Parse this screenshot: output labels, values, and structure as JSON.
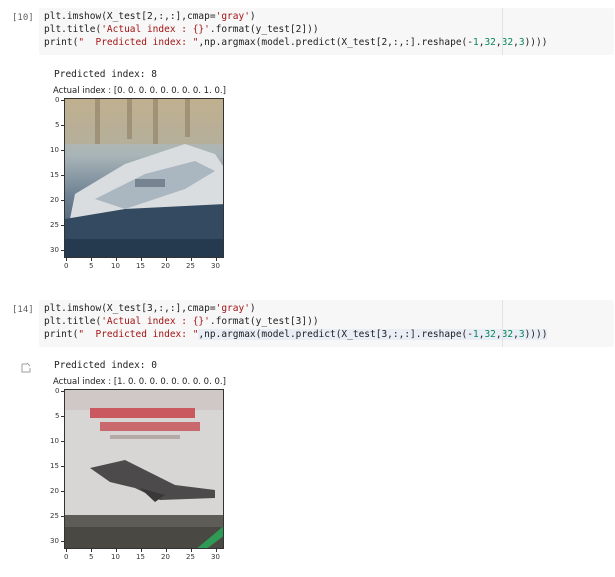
{
  "cells": [
    {
      "prompt": "[10]",
      "code": {
        "line1_a": "plt.imshow(X_test[2,:,:],cmap=",
        "line1_str": "'gray'",
        "line1_b": ")",
        "line2_a": "plt.title(",
        "line2_str": "'Actual index : {}'",
        "line2_b": ".format(y_test[2]))",
        "line3_a": "print(",
        "line3_str": "\"  Predicted index: \"",
        "line3_b": ",np.argmax(model.predict(X_test[2,:,:].reshape(-",
        "line3_n1": "1",
        "line3_c": ",",
        "line3_n2": "32",
        "line3_d": ",",
        "line3_n3": "32",
        "line3_e": ",",
        "line3_n4": "3",
        "line3_f": "))))"
      },
      "output_text": "Predicted index:  8",
      "plot_title": "Actual index : [0. 0. 0. 0. 0. 0. 0. 0. 1. 0.]",
      "y_ticks": [
        "0",
        "5",
        "10",
        "15",
        "20",
        "25",
        "30"
      ],
      "x_ticks": [
        "0",
        "5",
        "10",
        "15",
        "20",
        "25",
        "30"
      ]
    },
    {
      "prompt": "[14]",
      "code": {
        "line1_a": "plt.imshow(X_test[3,:,:],cmap=",
        "line1_str": "'gray'",
        "line1_b": ")",
        "line2_a": "plt.title(",
        "line2_str": "'Actual index : {}'",
        "line2_b": ".format(y_test[3]))",
        "line3_a": "print(",
        "line3_str": "\"  Predicted index: \"",
        "line3_b": ",np.argmax(model.predict(X_test[3,:,:].reshape(-",
        "line3_n1": "1",
        "line3_c": ",",
        "line3_n2": "32",
        "line3_d": ",",
        "line3_n3": "32",
        "line3_e": ",",
        "line3_n4": "3",
        "line3_f": "))))"
      },
      "output_text": "Predicted index:  0",
      "plot_title": "Actual index : [1. 0. 0. 0. 0. 0. 0. 0. 0. 0.]",
      "y_ticks": [
        "0",
        "5",
        "10",
        "15",
        "20",
        "25",
        "30"
      ],
      "x_ticks": [
        "0",
        "5",
        "10",
        "15",
        "20",
        "25",
        "30"
      ]
    }
  ]
}
